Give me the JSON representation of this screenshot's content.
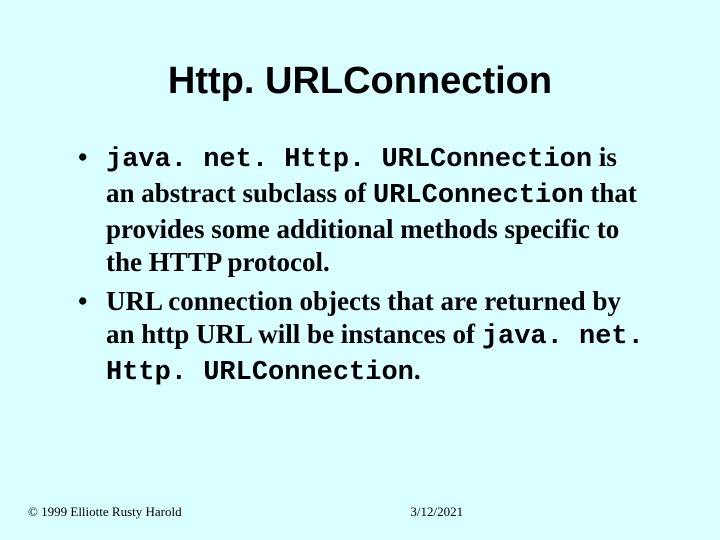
{
  "title": "Http. URLConnection",
  "bullets": [
    {
      "segments": [
        {
          "text": "java. net. Http. URLConnection",
          "mono": true
        },
        {
          "text": " is an abstract subclass of ",
          "mono": false
        },
        {
          "text": "URLConnection",
          "mono": true
        },
        {
          "text": " that provides some additional methods specific to the HTTP protocol.",
          "mono": false
        }
      ]
    },
    {
      "segments": [
        {
          "text": "URL connection objects that are returned by an http URL will be instances of ",
          "mono": false
        },
        {
          "text": "java. net. Http. URLConnection",
          "mono": true
        },
        {
          "text": ".",
          "mono": false
        }
      ]
    }
  ],
  "footer": {
    "copyright": "© 1999 Elliotte Rusty Harold",
    "date": "3/12/2021"
  }
}
